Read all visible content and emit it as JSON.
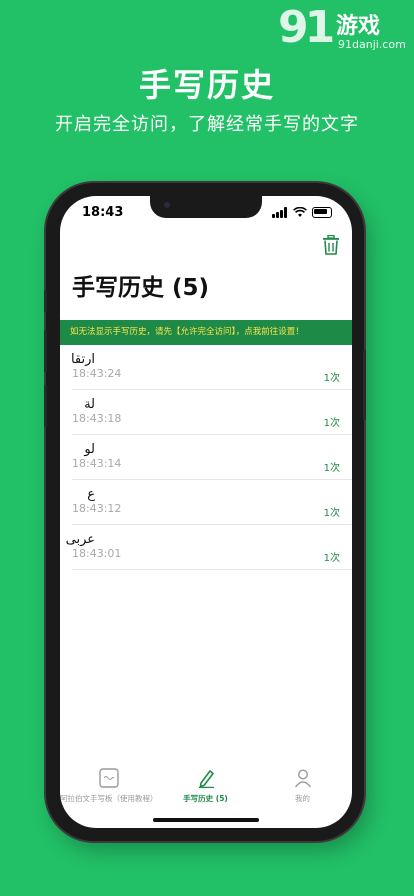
{
  "watermark": {
    "logo": "91",
    "brand": "游戏",
    "url": "91danji.com"
  },
  "promo": {
    "headline": "手写历史",
    "subline": "开启完全访问，了解经常手写的文字"
  },
  "status_bar": {
    "time": "18:43"
  },
  "header": {
    "title": "手写历史 (5)"
  },
  "banner": {
    "text": "如无法显示手写历史，请先【允许完全访问】，点我前往设置！"
  },
  "history": [
    {
      "text": "ارتقا",
      "time": "18:43:24",
      "count": "1次"
    },
    {
      "text": "لة",
      "time": "18:43:18",
      "count": "1次"
    },
    {
      "text": "لو",
      "time": "18:43:14",
      "count": "1次"
    },
    {
      "text": "ع",
      "time": "18:43:12",
      "count": "1次"
    },
    {
      "text": "عربى",
      "time": "18:43:01",
      "count": "1次"
    }
  ],
  "tabs": [
    {
      "label": "阿拉伯文手写板（使用教程）",
      "icon": "keyboard-icon",
      "active": false
    },
    {
      "label": "手写历史 (5)",
      "icon": "pen-icon",
      "active": true
    },
    {
      "label": "我的",
      "icon": "person-icon",
      "active": false
    }
  ],
  "colors": {
    "background": "#22c067",
    "accent": "#1e8a47",
    "banner_text": "#ffe24a"
  }
}
